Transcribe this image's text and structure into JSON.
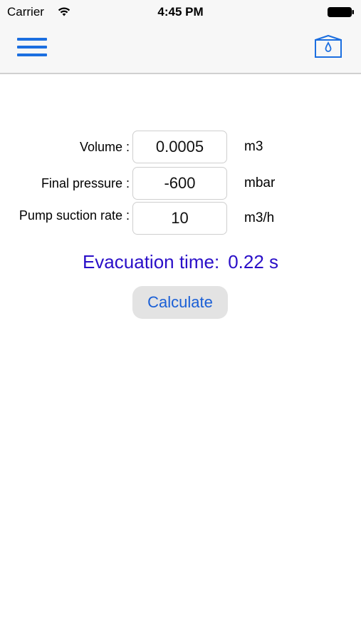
{
  "status_bar": {
    "carrier": "Carrier",
    "time": "4:45 PM"
  },
  "nav": {
    "menu_icon": "hamburger-menu-icon",
    "tank_icon": "water-tank-icon",
    "accent_color": "#1c6fe0"
  },
  "form": {
    "rows": [
      {
        "label": "Volume :",
        "value": "0.0005",
        "unit": "m3"
      },
      {
        "label": "Final pressure :",
        "value": "-600",
        "unit": "mbar"
      },
      {
        "label": "Pump suction rate :",
        "value": "10",
        "unit": "m3/h"
      }
    ]
  },
  "result": {
    "label": "Evacuation time:",
    "value": "0.22 s",
    "color": "#2a0fc8"
  },
  "calculate_button": {
    "label": "Calculate"
  }
}
